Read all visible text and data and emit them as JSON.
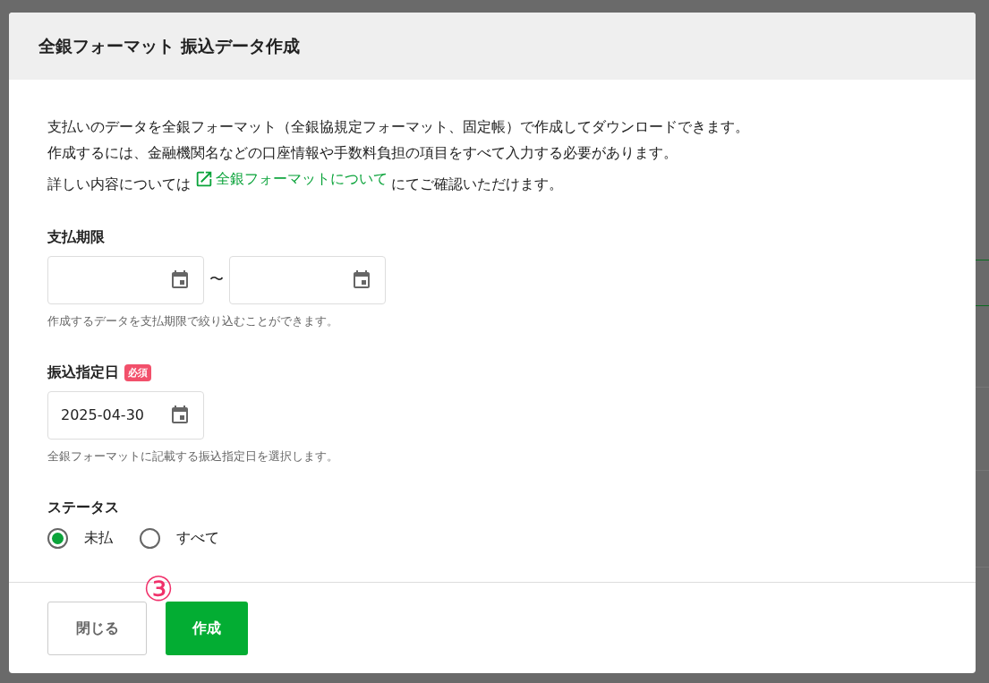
{
  "dialog": {
    "title": "全銀フォーマット 振込データ作成",
    "intro_lines": [
      "支払いのデータを全銀フォーマット（全銀協規定フォーマット、固定帳）で作成してダウンロードできます。",
      "作成するには、金融機関名などの口座情報や手数料負担の項目をすべて入力する必要があります。"
    ],
    "link_line": {
      "before": "詳しい内容については",
      "link": "全銀フォーマットについて",
      "after": "にてご確認いただけます。"
    },
    "due_range": {
      "label": "支払期限",
      "separator": "〜",
      "hint": "作成するデータを支払期限で絞り込むことができます。"
    },
    "transfer_date": {
      "label": "振込指定日",
      "badge": "必須",
      "value": "2025-04-30",
      "hint": "全銀フォーマットに記載する振込指定日を選択します。"
    },
    "status": {
      "label": "ステータス",
      "options": [
        {
          "label": "未払",
          "selected": true
        },
        {
          "label": "すべて",
          "selected": false
        }
      ]
    },
    "buttons": [
      {
        "label": "閉じる",
        "kind": "secondary"
      },
      {
        "label": "作成",
        "kind": "primary"
      }
    ],
    "annotation": "③"
  }
}
